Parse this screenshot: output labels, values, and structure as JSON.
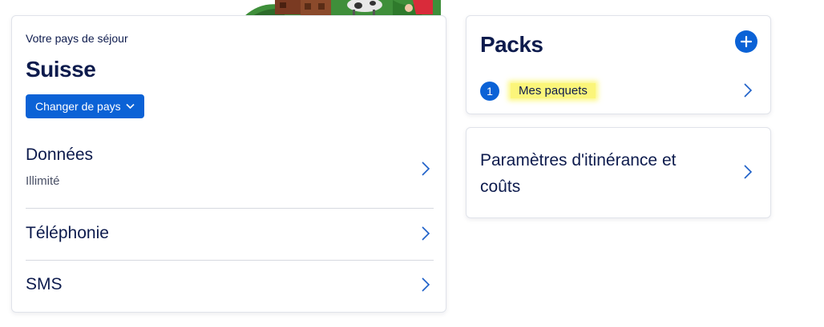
{
  "country_card": {
    "label": "Votre pays de séjour",
    "country": "Suisse",
    "change_button": "Changer de pays",
    "rows": [
      {
        "title": "Données",
        "subtitle": "Illimité"
      },
      {
        "title": "Téléphonie"
      },
      {
        "title": "SMS"
      }
    ]
  },
  "packs_card": {
    "title": "Packs",
    "count": "1",
    "link_label": "Mes paquets"
  },
  "roaming_card": {
    "title": "Paramètres d'itinérance et coûts"
  },
  "colors": {
    "accent": "#0b62d6",
    "text_dark": "#0d1b4d",
    "highlight": "#fbf57a"
  },
  "icons": [
    "chevron-right-icon",
    "chevron-down-icon",
    "plus-icon"
  ]
}
